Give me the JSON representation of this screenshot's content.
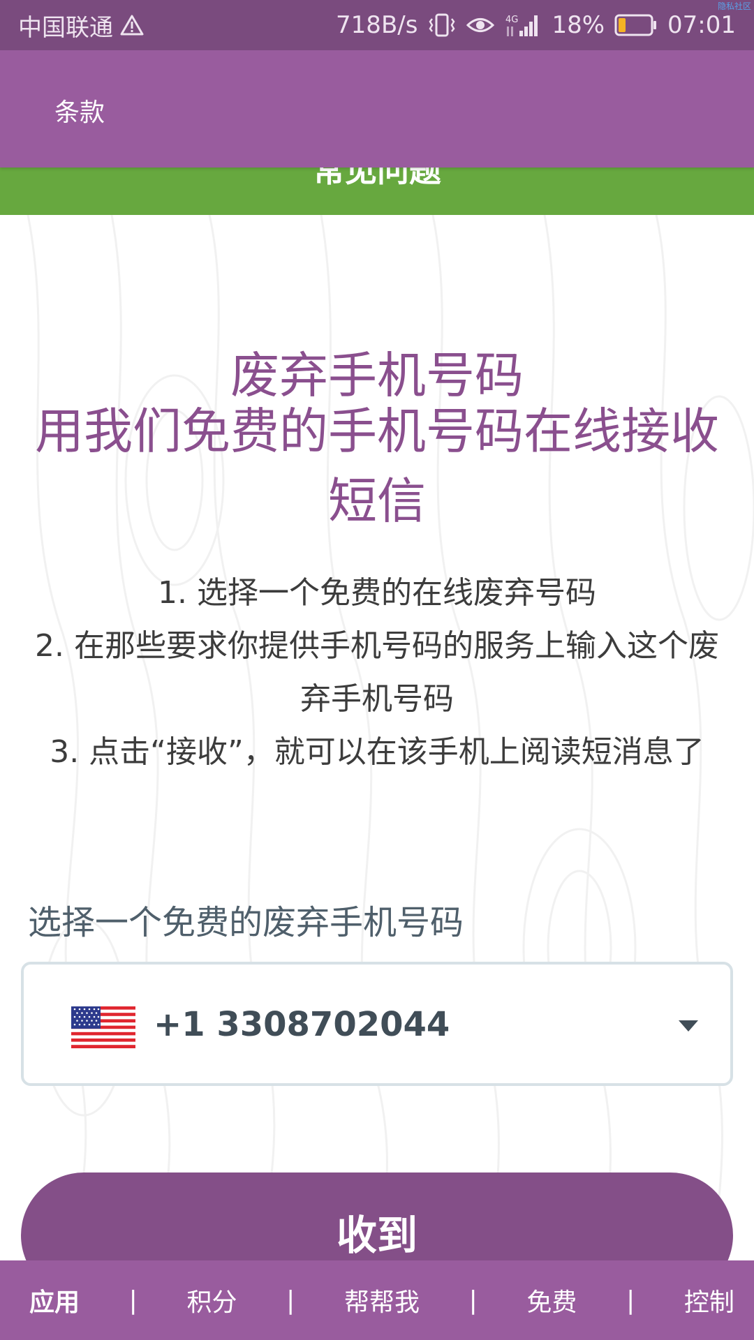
{
  "status_bar": {
    "carrier": "中国联通",
    "net_speed": "718B/s",
    "battery_percent": "18%",
    "time": "07:01",
    "network_type": "4G",
    "watermark": "隐私社区"
  },
  "header": {
    "title": "条款"
  },
  "faq_bar": {
    "label": "常见问题"
  },
  "hero": {
    "line1": "废弃手机号码",
    "line2": "用我们免费的手机号码在线接收短信"
  },
  "steps": [
    "1. 选择一个免费的在线废弃号码",
    "2. 在那些要求你提供手机号码的服务上输入这个废弃手机号码",
    "3. 点击“接收”，就可以在该手机上阅读短消息了"
  ],
  "select": {
    "label": "选择一个免费的废弃手机号码",
    "selected_value": "+1 3308702044",
    "flag": "us-flag-icon"
  },
  "receive_button": {
    "label": "收到"
  },
  "bottom_nav": {
    "items": [
      "应用",
      "积分",
      "帮帮我",
      "免费",
      "控制"
    ],
    "separator": "|"
  },
  "colors": {
    "status_bar": "#7a4b7e",
    "header": "#995c9e",
    "faq_green": "#67a83f",
    "hero_text": "#8a4f8e",
    "button": "#844f88"
  }
}
